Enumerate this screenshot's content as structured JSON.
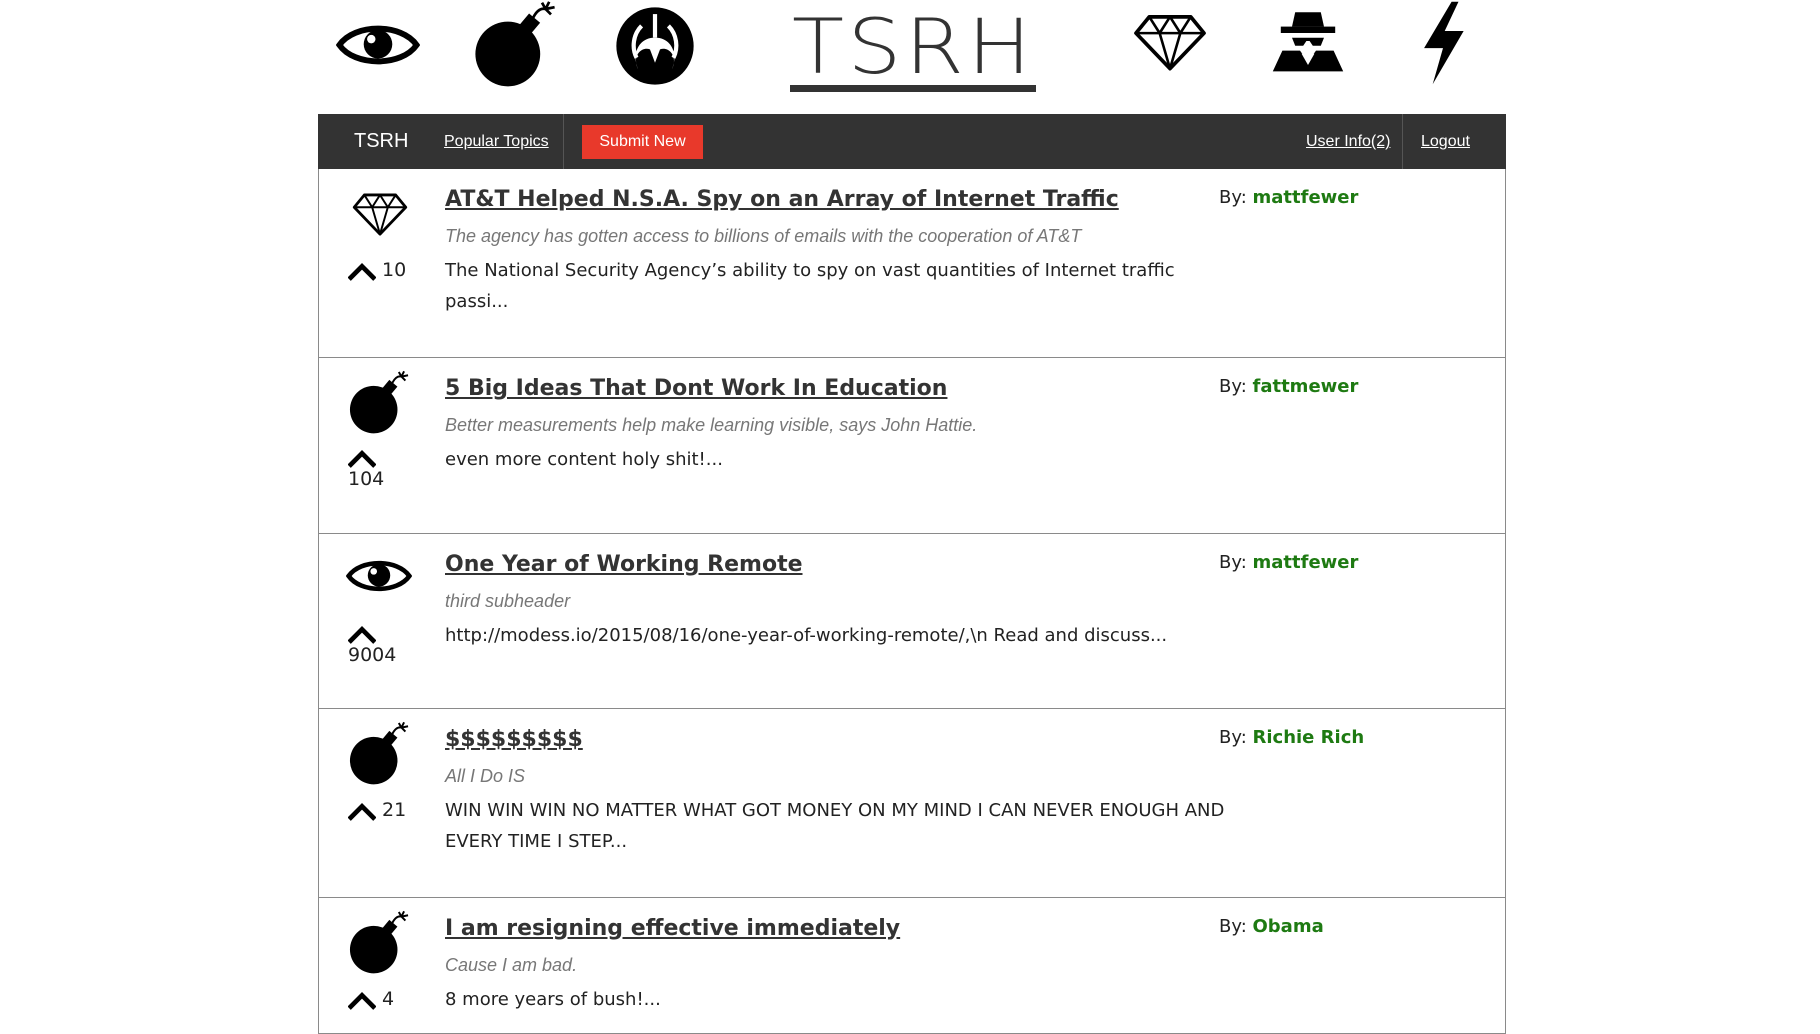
{
  "banner": {
    "logo_text": "TSRH",
    "icons": [
      "eye-icon",
      "bomb-icon",
      "rebel-alliance-icon",
      "diamond-icon",
      "spy-icon",
      "lightning-icon"
    ]
  },
  "navbar": {
    "brand": "TSRH",
    "popular_topics": "Popular Topics",
    "submit_new": "Submit New",
    "user_info": "User Info(2)",
    "logout": "Logout",
    "bg_color": "#333333",
    "submit_color": "#e8392b"
  },
  "colors": {
    "author": "#1e7a12"
  },
  "posts": [
    {
      "icon": "diamond-icon",
      "votes": "10",
      "title": "AT&T Helped N.S.A. Spy on an Array of Internet Traffic",
      "subtitle": "The agency has gotten access to billions of emails with the cooperation of AT&T",
      "body": "The National Security Agency’s ability to spy on vast quantities of Internet traffic passi...",
      "by_label": "By:",
      "author": "mattfewer"
    },
    {
      "icon": "bomb-icon",
      "votes": "104",
      "title": "5 Big Ideas That Dont Work In Education",
      "subtitle": "Better measurements help make learning visible, says John Hattie.",
      "body": "even more content holy shit!...",
      "by_label": "By:",
      "author": "fattmewer"
    },
    {
      "icon": "eye-icon",
      "votes": "9004",
      "title": "One Year of Working Remote",
      "subtitle": "third subheader",
      "body": "http://modess.io/2015/08/16/one-year-of-working-remote/,\\n Read and discuss...",
      "by_label": "By:",
      "author": "mattfewer"
    },
    {
      "icon": "bomb-icon",
      "votes": "21",
      "title": "$$$$$$$$$",
      "subtitle": "All I Do IS",
      "body": "WIN WIN WIN NO MATTER WHAT GOT MONEY ON MY MIND I CAN NEVER ENOUGH AND EVERY TIME I STEP...",
      "by_label": "By:",
      "author": "Richie Rich"
    },
    {
      "icon": "bomb-icon",
      "votes": "4",
      "title": "I am resigning effective immediately",
      "subtitle": "Cause I am bad.",
      "body": "8 more years of bush!...",
      "by_label": "By:",
      "author": "Obama"
    }
  ]
}
